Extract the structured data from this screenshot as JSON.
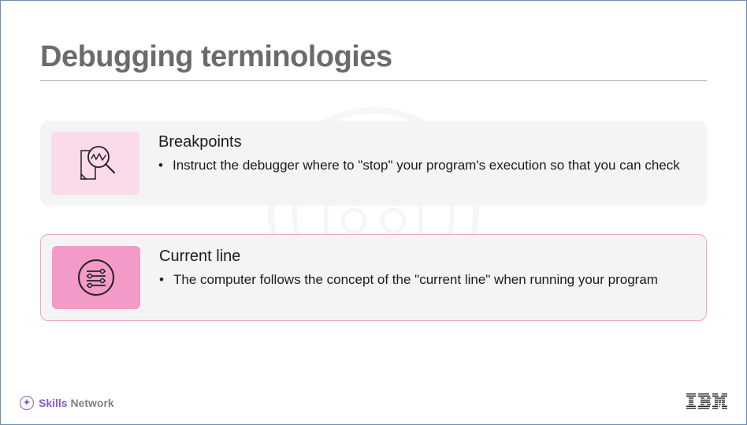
{
  "slide": {
    "title": "Debugging terminologies"
  },
  "cards": [
    {
      "heading": "Breakpoints",
      "bullet": "Instruct the debugger where to \"stop\" your program's execution so that you can check",
      "icon_bg_class": "light-pink",
      "highlighted": false
    },
    {
      "heading": "Current line",
      "bullet": "The computer follows the concept of the \"current line\" when running your program",
      "icon_bg_class": "mid-pink",
      "highlighted": true
    }
  ],
  "footer": {
    "skills": "Skills",
    "network": "Network",
    "ibm": "IBM"
  }
}
